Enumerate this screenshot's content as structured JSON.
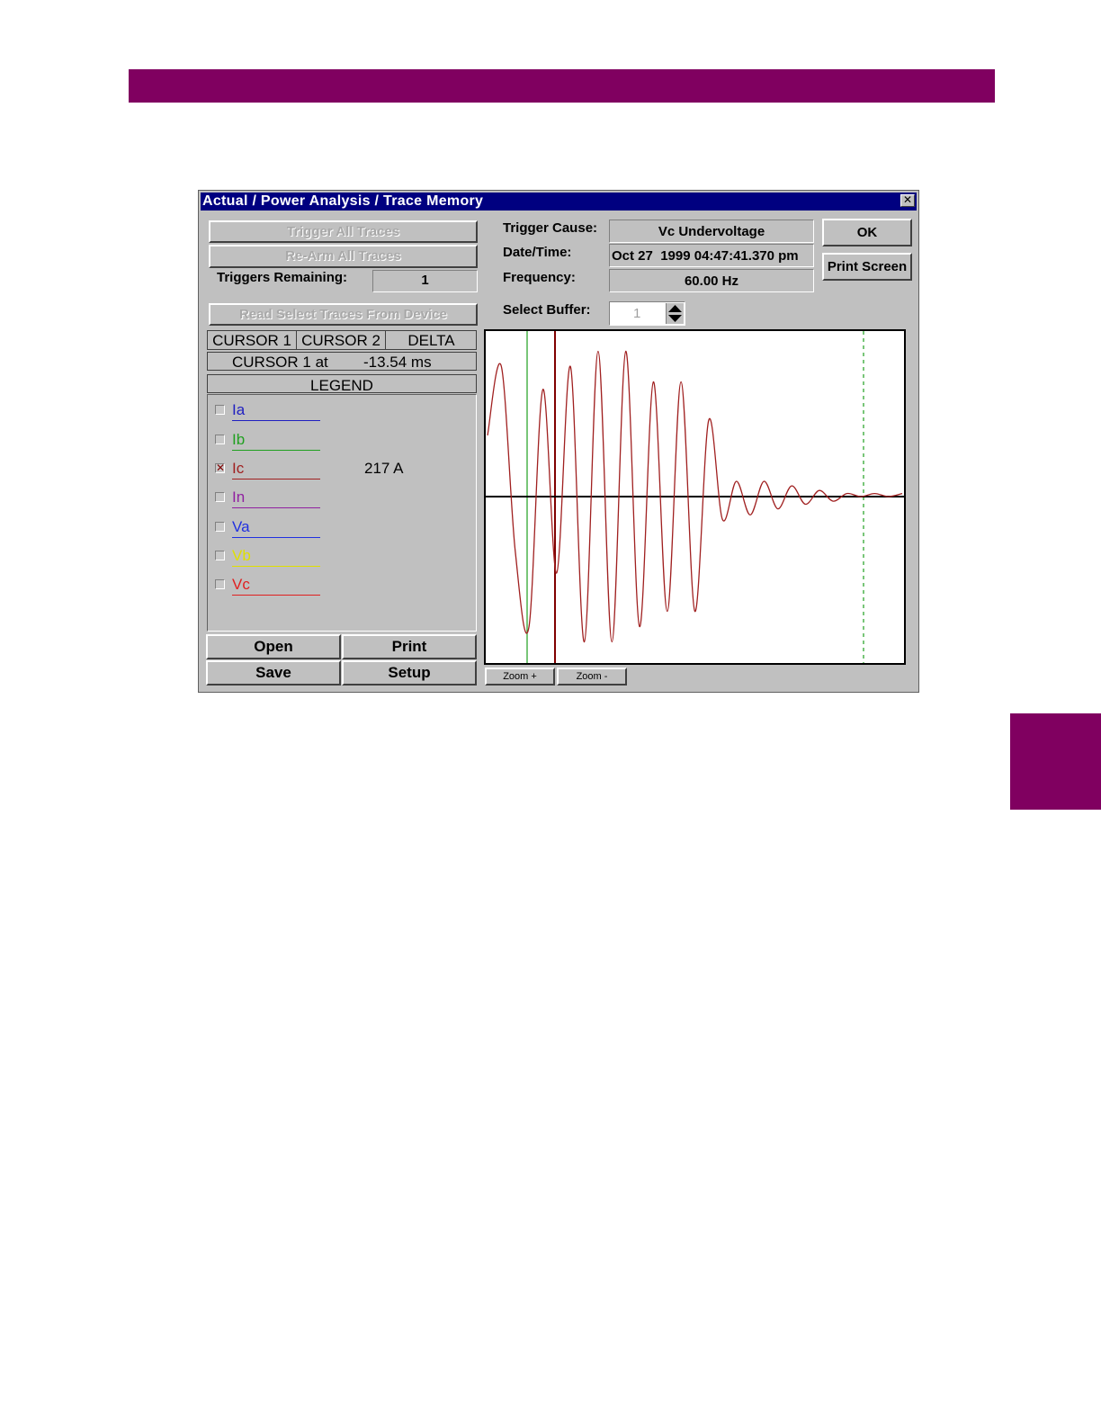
{
  "window": {
    "title": "Actual / Power Analysis / Trace Memory",
    "close_glyph": "✕"
  },
  "buttons": {
    "trigger_all": "Trigger All Traces",
    "rearm_all": "Re-Arm All Traces",
    "read_select": "Read Select Traces From Device",
    "ok": "OK",
    "print_screen": "Print Screen",
    "open": "Open",
    "print": "Print",
    "save": "Save",
    "setup": "Setup",
    "zoom_in": "Zoom +",
    "zoom_out": "Zoom -"
  },
  "triggers_remaining": {
    "label": "Triggers Remaining:",
    "value": "1"
  },
  "info": {
    "trigger_cause_label": "Trigger Cause:",
    "trigger_cause_value": "Vc Undervoltage",
    "datetime_label": "Date/Time:",
    "datetime_value": "Oct 27  1999 04:47:41.370 pm",
    "frequency_label": "Frequency:",
    "frequency_value": "60.00 Hz",
    "select_buffer_label": "Select Buffer:",
    "select_buffer_value": "1"
  },
  "cursor_tabs": [
    "CURSOR 1",
    "CURSOR 2",
    "DELTA"
  ],
  "cursor_readout": {
    "label": "CURSOR 1 at",
    "value": "-13.54 ms"
  },
  "legend": {
    "title": "LEGEND",
    "items": [
      {
        "name": "Ia",
        "color": "#2020c0",
        "checked": false,
        "value": ""
      },
      {
        "name": "Ib",
        "color": "#20a020",
        "checked": false,
        "value": ""
      },
      {
        "name": "Ic",
        "color": "#a02020",
        "checked": true,
        "value": "217 A"
      },
      {
        "name": "In",
        "color": "#9020a0",
        "checked": false,
        "value": ""
      },
      {
        "name": "Va",
        "color": "#2030e0",
        "checked": false,
        "value": ""
      },
      {
        "name": "Vb",
        "color": "#e0e000",
        "checked": false,
        "value": ""
      },
      {
        "name": "Vc",
        "color": "#e02020",
        "checked": false,
        "value": ""
      }
    ]
  },
  "chart_data": {
    "type": "line",
    "series": [
      {
        "name": "Ic",
        "color": "#a02020",
        "y": [
          0.4,
          0.85,
          -0.35,
          -0.85,
          0.7,
          -0.5,
          0.85,
          -0.95,
          0.95,
          -0.95,
          0.95,
          -0.85,
          0.75,
          -0.75,
          0.75,
          -0.75,
          0.5,
          -0.15,
          0.1,
          -0.12,
          0.1,
          -0.08,
          0.07,
          -0.05,
          0.04,
          -0.03,
          0.02,
          0,
          0.02,
          0,
          0.02
        ]
      }
    ],
    "ylim": [
      -1,
      1
    ],
    "colors": {
      "cursor1": "#20a020",
      "cursor2": "#800000",
      "axis": "#000000"
    }
  }
}
